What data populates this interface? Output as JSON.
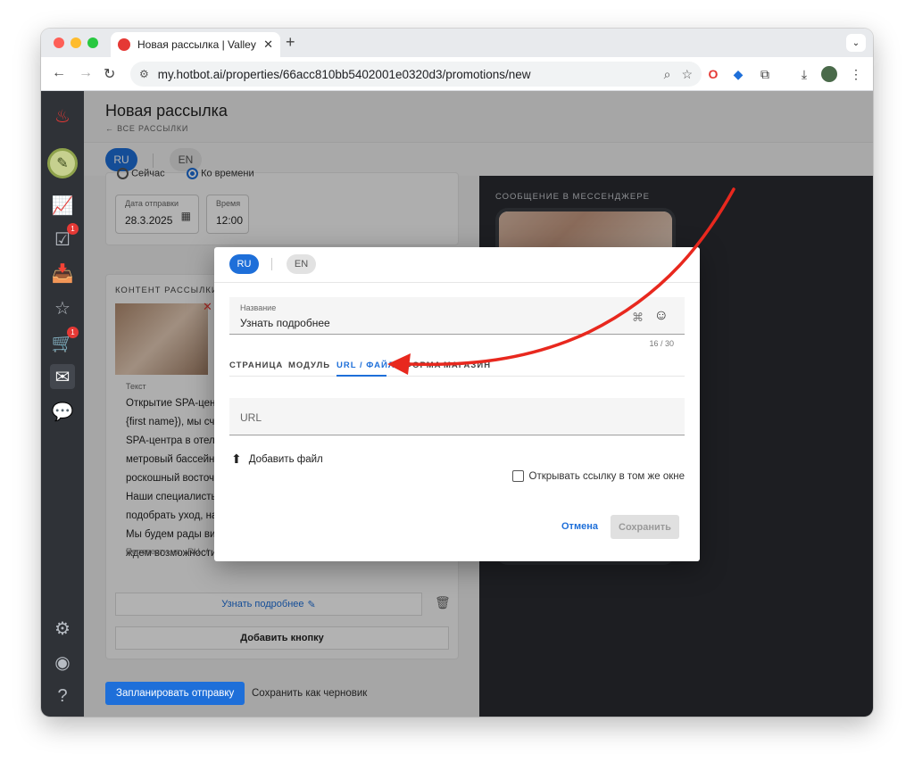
{
  "browser": {
    "tab_title": "Новая рассылка | Valley Hotel",
    "url": "my.hotbot.ai/properties/66acc810bb5402001e0320d3/promotions/new",
    "new_tab_symbol": "+",
    "traffic_colors": [
      "#fe5f57",
      "#febc2e",
      "#28c840"
    ]
  },
  "sidebar": {
    "badges": {
      "tasks": "1",
      "shop": "1"
    }
  },
  "page": {
    "title": "Новая рассылка",
    "back_link": "← ВСЕ РАССЫЛКИ",
    "langs": [
      "RU",
      "EN"
    ]
  },
  "schedule": {
    "now_label": "Сейчас",
    "time_label": "Ко времени",
    "date_label": "Дата отправки",
    "date_value": "28.3.2025",
    "time_field_label": "Время",
    "time_value": "12:00"
  },
  "content": {
    "section_title": "КОНТЕНТ РАССЫЛКИ",
    "text_label": "Текст",
    "text_lines": [
      "Открытие SPA-цент",
      "{first name}), мы сча",
      "SPA-центра в отеле",
      "метровый бассейн с",
      "роскошный восточн",
      "Наши специалисты",
      "подобрать уход, нак",
      "Мы будем рады вид",
      "ждем возможности"
    ],
    "translate_label": "Перевести на",
    "translate_ru": "RU",
    "translate_sep": "/",
    "translate_en": "EN",
    "button_label": "Узнать подробнее",
    "add_button": "Добавить кнопку"
  },
  "actions": {
    "schedule": "Запланировать отправку",
    "draft": "Сохранить как черновик"
  },
  "preview": {
    "label": "СООБЩЕНИЕ В МЕССЕНДЖЕРЕ"
  },
  "modal": {
    "langs": [
      "RU",
      "EN"
    ],
    "name_label": "Название",
    "name_value": "Узнать подробнее",
    "counter": "16 / 30",
    "tabs": [
      "СТРАНИЦА",
      "МОДУЛЬ",
      "URL / ФАЙЛ",
      "ФОРМА",
      "МАГАЗИН"
    ],
    "active_tab": "URL / ФАЙЛ",
    "url_placeholder": "URL",
    "upload_label": "Добавить файл",
    "same_window_label": "Открывать ссылку в том же окне",
    "cancel": "Отмена",
    "save": "Сохранить"
  },
  "colors": {
    "accent": "#1e6fd9",
    "annotation_arrow": "#e8281e",
    "sidebar": "#2f3237",
    "preview_bg": "#2a2c31"
  }
}
